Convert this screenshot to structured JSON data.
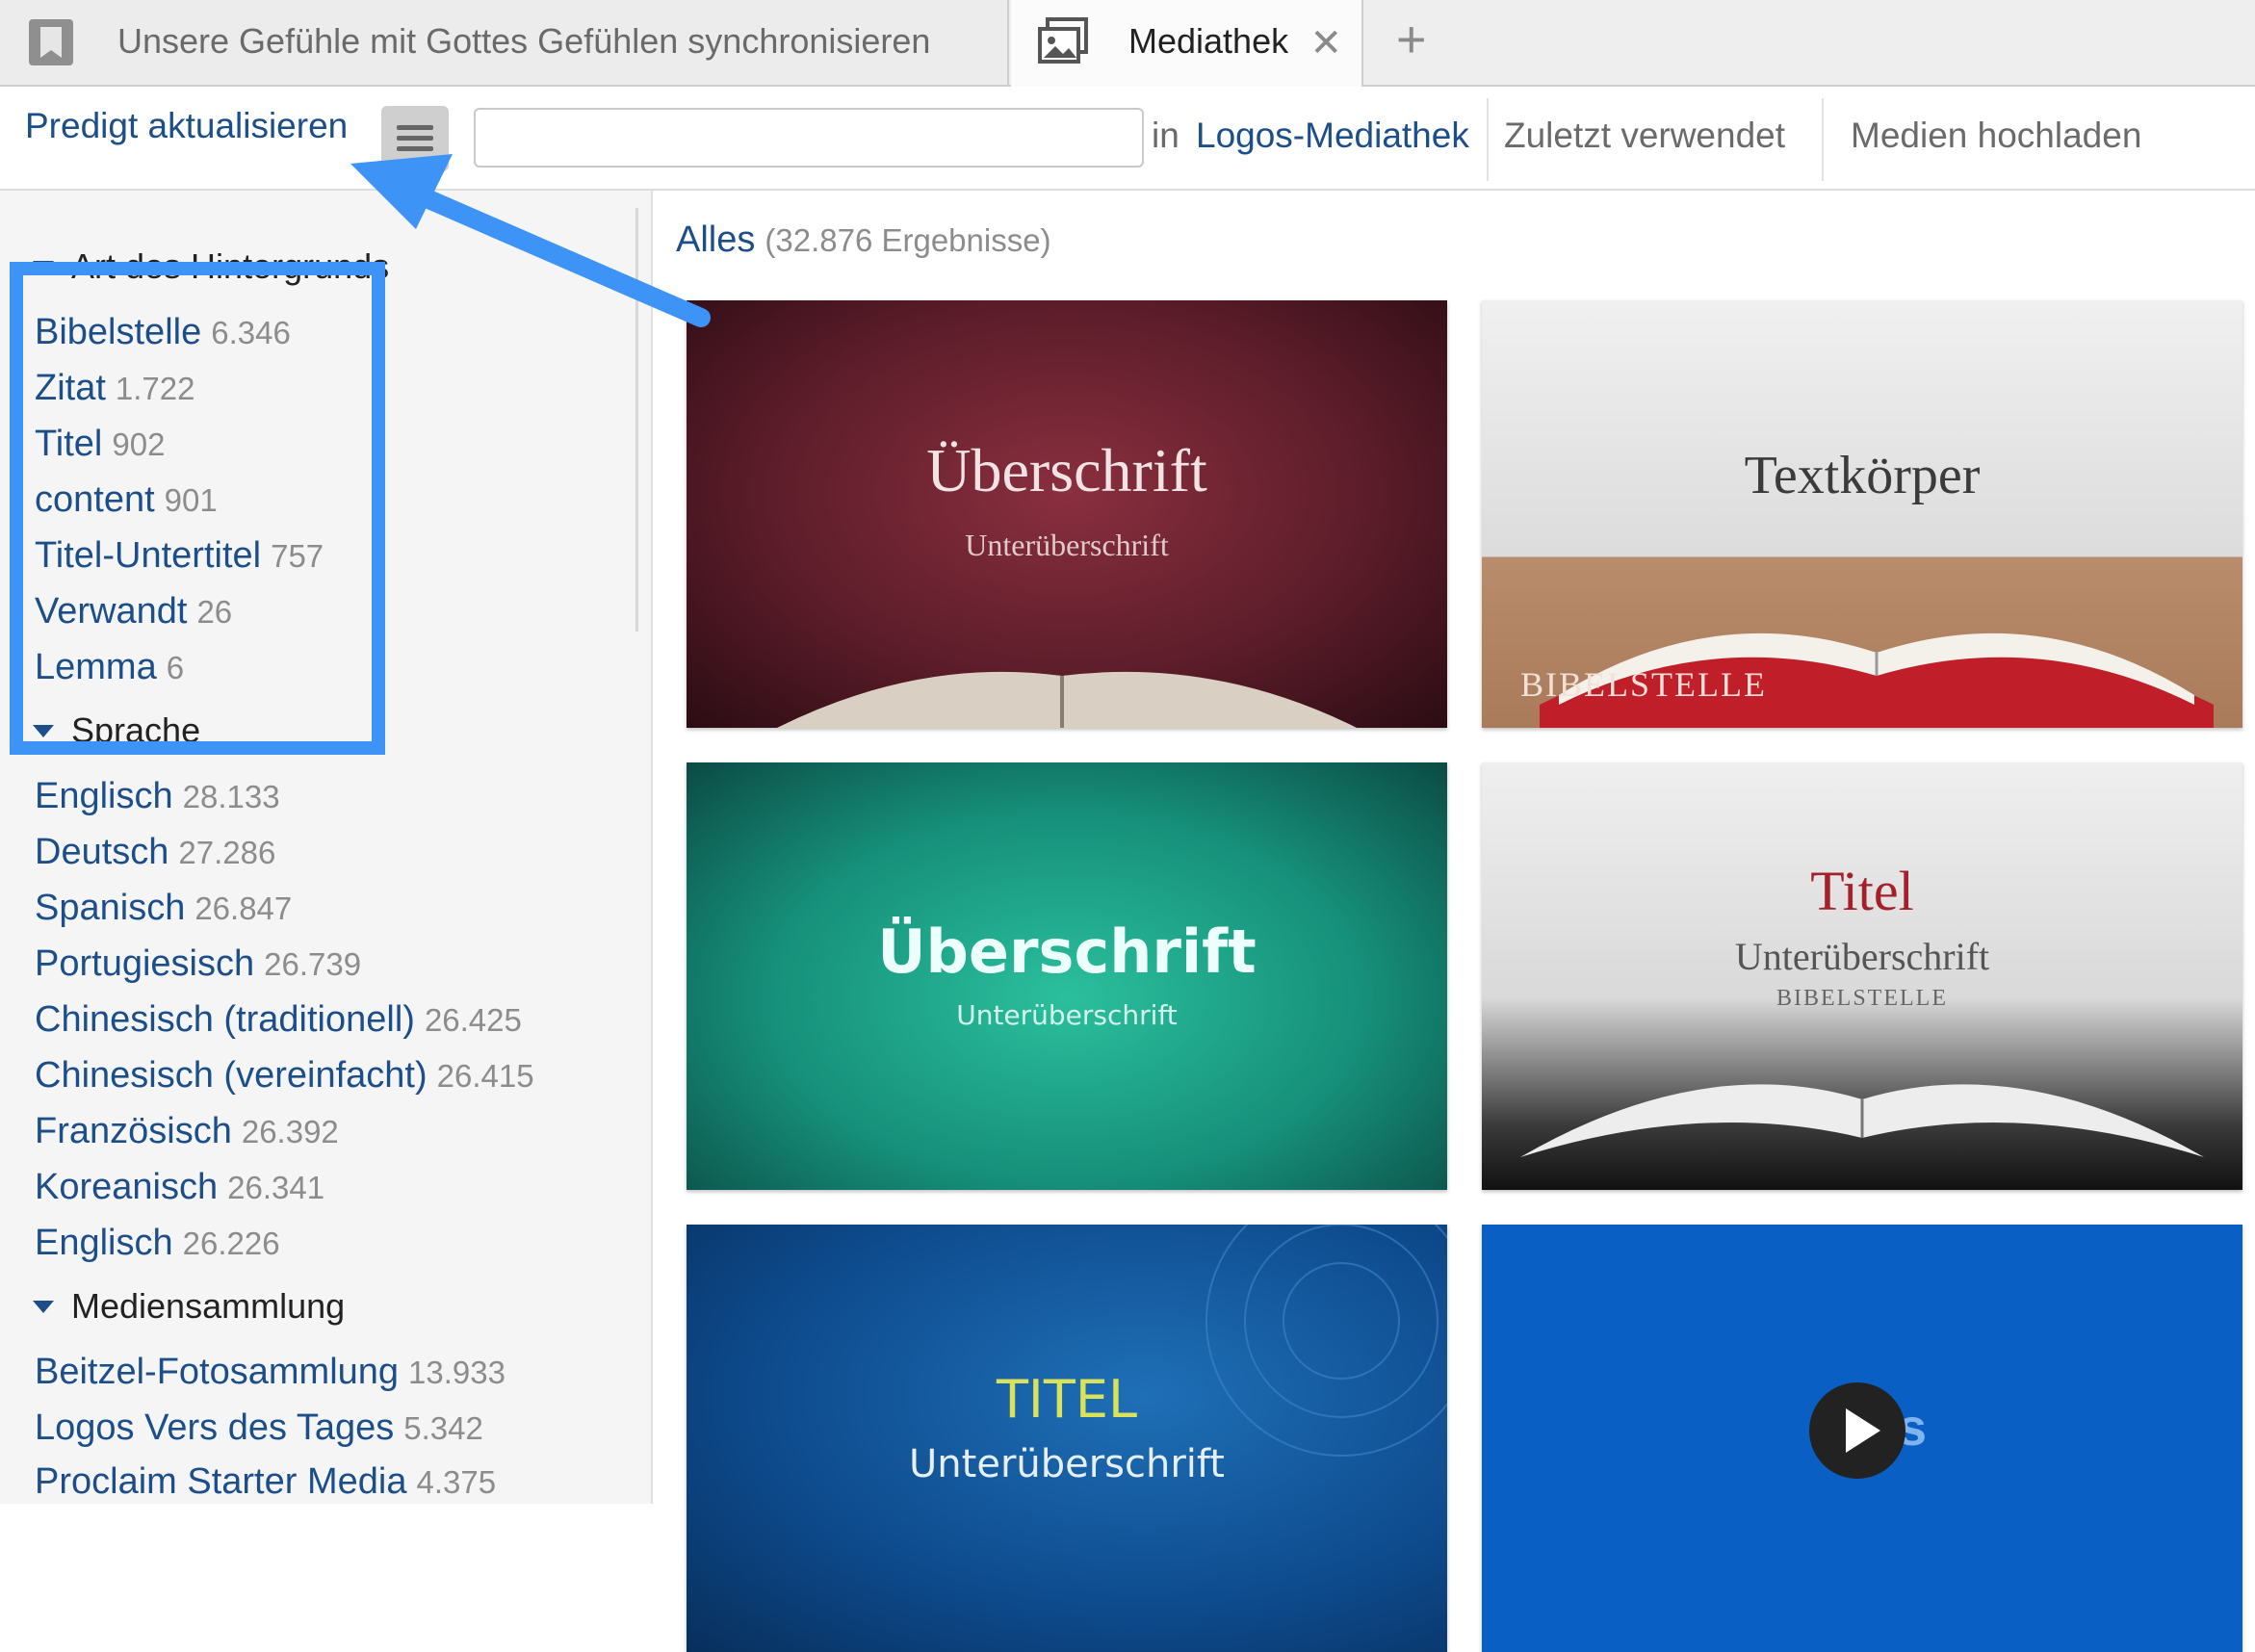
{
  "tabs": [
    {
      "label": "Unsere Gefühle mit Gottes Gefühlen synchronisieren",
      "icon": "bookmark-icon"
    },
    {
      "label": "Mediathek",
      "icon": "media-library-icon",
      "close": "✕"
    }
  ],
  "tab_add": "+",
  "toolbar": {
    "sermon_link": "Predigt aktualisieren",
    "search_value": "",
    "in_label": "in",
    "library_link": "Logos-Mediathek",
    "recent": "Zuletzt verwendet",
    "upload": "Medien hochladen"
  },
  "sidebar": {
    "groups": [
      {
        "title": "Art des Hintergrunds",
        "items": [
          {
            "label": "Bibelstelle",
            "count": "6.346"
          },
          {
            "label": "Zitat",
            "count": "1.722"
          },
          {
            "label": "Titel",
            "count": "902"
          },
          {
            "label": "content",
            "count": "901"
          },
          {
            "label": "Titel-Untertitel",
            "count": "757"
          },
          {
            "label": "Verwandt",
            "count": "26"
          },
          {
            "label": "Lemma",
            "count": "6"
          }
        ]
      },
      {
        "title": "Sprache",
        "items": [
          {
            "label": "Englisch",
            "count": "28.133"
          },
          {
            "label": "Deutsch",
            "count": "27.286"
          },
          {
            "label": "Spanisch",
            "count": "26.847"
          },
          {
            "label": "Portugiesisch",
            "count": "26.739"
          },
          {
            "label": "Chinesisch (traditionell)",
            "count": "26.425"
          },
          {
            "label": "Chinesisch (vereinfacht)",
            "count": "26.415"
          },
          {
            "label": "Französisch",
            "count": "26.392"
          },
          {
            "label": "Koreanisch",
            "count": "26.341"
          },
          {
            "label": "Englisch",
            "count": "26.226"
          }
        ]
      },
      {
        "title": "Mediensammlung",
        "items": [
          {
            "label": "Beitzel-Fotosammlung",
            "count": "13.933"
          },
          {
            "label": "Logos Vers des Tages",
            "count": "5.342"
          },
          {
            "label": "Proclaim Starter Media",
            "count": "4.375"
          }
        ]
      }
    ]
  },
  "results": {
    "label": "Alles",
    "count": "(32.876 Ergebnisse)"
  },
  "thumbnails": [
    {
      "title": "Überschrift",
      "subtitle": "Unterüberschrift"
    },
    {
      "title": "Textkörper",
      "reference": "BIBELSTELLE"
    },
    {
      "title": "Überschrift",
      "subtitle": "Unterüberschrift"
    },
    {
      "title": "Titel",
      "subtitle": "Unterüberschrift",
      "reference": "BIBELSTELLE"
    },
    {
      "title": "TITEL",
      "subtitle": "Unterüberschrift"
    },
    {
      "letter": "s",
      "icon": "play-icon"
    }
  ],
  "colors": {
    "link": "#1c4e8a",
    "annotation": "#3d94f6",
    "count": "#8c8c8c"
  }
}
